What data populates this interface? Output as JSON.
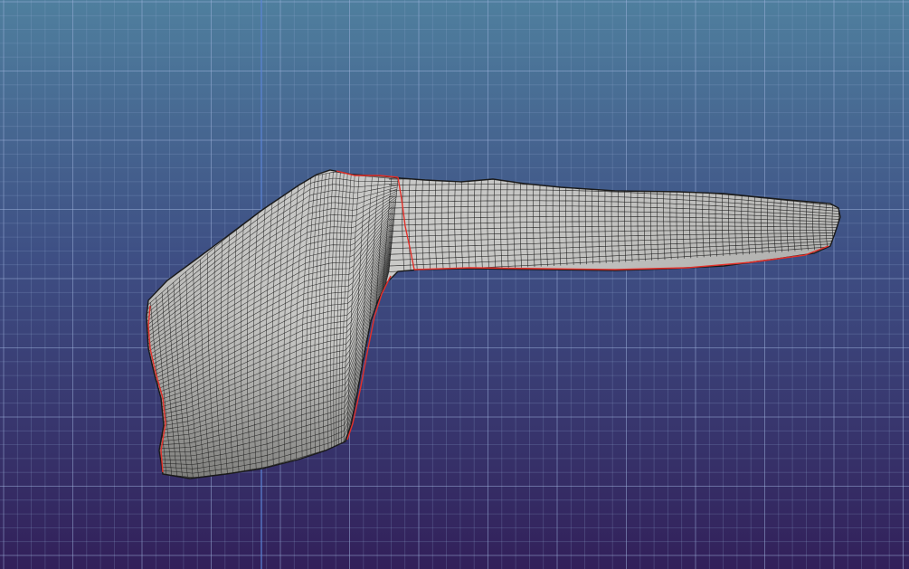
{
  "viewport": {
    "background_top": "#4f7f9e",
    "background_bottom": "#32205a",
    "grid_minor_color": "#8fa9cf",
    "grid_major_color": "#9fb4de",
    "vertical_axis_color": "#5b84d6",
    "grid_visible": true
  },
  "mesh": {
    "object": "sleeve-mesh",
    "surface_color": "#c9c9c6",
    "surface_shadow": "#8f8f8c",
    "surface_highlight": "#ececea",
    "wire_color": "#1a1a1a",
    "seam_color": "#e3302a"
  }
}
